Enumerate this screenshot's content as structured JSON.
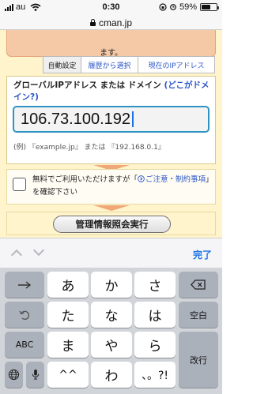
{
  "status_bar": {
    "carrier": "au",
    "time": "0:30",
    "battery": "59%",
    "battery_level": 0.59
  },
  "browser": {
    "url": "cman.jp"
  },
  "notice": {
    "text": "ます。"
  },
  "tabs": [
    {
      "label": "自動設定",
      "active": true
    },
    {
      "label": "履歴から選択",
      "active": false
    },
    {
      "label": "現在のIPアドレス",
      "active": false
    }
  ],
  "form": {
    "label": "グローバルIPアドレス または ドメイン",
    "label_hint": "(どこがドメイン?)",
    "ip_value": "106.73.100.192",
    "example": "(例) 『example.jp』 または 『192.168.0.1』"
  },
  "consent": {
    "text_before": "無料でご利用いただけますが「",
    "link_text": "ご注意・制約事項",
    "text_after": "」を確認下さい"
  },
  "execute_button": "管理情報照会実行",
  "accessory": {
    "done": "完了"
  },
  "keyboard": {
    "row1": [
      "あ",
      "か",
      "さ"
    ],
    "row2": [
      "た",
      "な",
      "は"
    ],
    "row3": [
      "ま",
      "や",
      "ら"
    ],
    "row4": [
      "^^",
      "わ",
      "、。?!"
    ],
    "space": "空白",
    "abc": "ABC",
    "return": "改行",
    "icons": [
      "arrow-right-icon",
      "undo-icon",
      "delete-icon",
      "globe-icon",
      "microphone-icon"
    ]
  },
  "colors": {
    "page_bg": "#fff4cc",
    "notice_bg": "#f6c9a6",
    "link": "#2b55c7",
    "input_border": "#2e95c2",
    "accent_blue": "#1a73e8"
  }
}
